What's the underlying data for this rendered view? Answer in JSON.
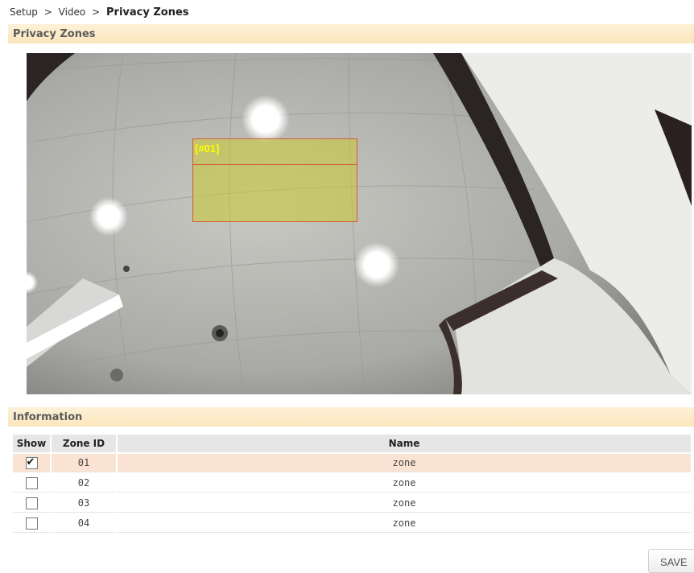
{
  "breadcrumb": {
    "items": [
      "Setup",
      "Video"
    ],
    "current": "Privacy Zones",
    "separator": ">"
  },
  "sections": {
    "privacy_title": "Privacy Zones",
    "info_title": "Information"
  },
  "video": {
    "zone_label": "[#01]"
  },
  "table": {
    "headers": {
      "show": "Show",
      "zone_id": "Zone ID",
      "name": "Name"
    },
    "rows": [
      {
        "checked": true,
        "id": "01",
        "name": "zone"
      },
      {
        "checked": false,
        "id": "02",
        "name": "zone"
      },
      {
        "checked": false,
        "id": "03",
        "name": "zone"
      },
      {
        "checked": false,
        "id": "04",
        "name": "zone"
      }
    ]
  },
  "buttons": {
    "save": "SAVE"
  },
  "colors": {
    "section_bar": "#fbe6bd",
    "selected_row": "#fbe3d3",
    "zone_fill": "#c8c83c",
    "zone_border": "#d05a3a",
    "zone_label": "#ffff00"
  }
}
